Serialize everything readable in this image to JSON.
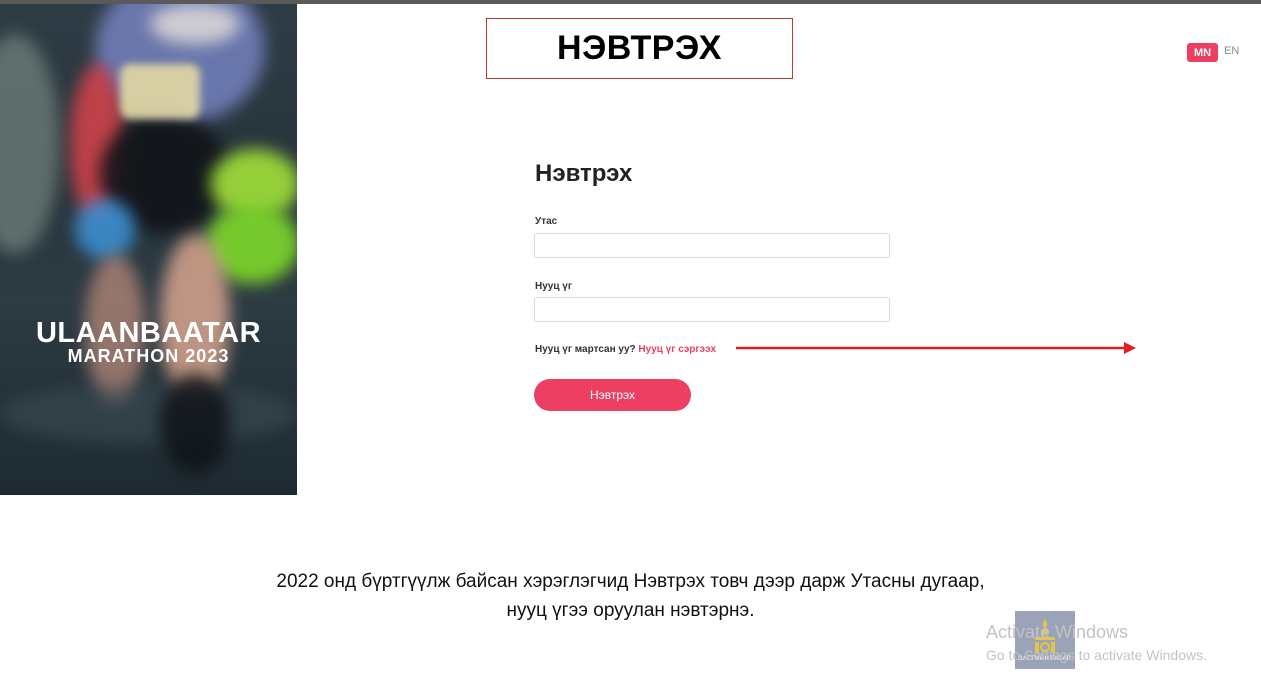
{
  "banner": {
    "title": "НЭВТРЭХ"
  },
  "hero": {
    "title": "ULAANBAATAR",
    "subtitle": "MARATHON 2023"
  },
  "language": {
    "active": "MN",
    "other": "EN"
  },
  "login_form": {
    "title": "Нэвтрэх",
    "phone_label": "Утас",
    "phone_value": "",
    "password_label": "Нууц үг",
    "password_value": "",
    "forgot_text": "Нууц үг мартсан уу?",
    "reset_link": "Нууц үг сэргээх",
    "submit_label": "Нэвтрэх"
  },
  "caption": {
    "line1": "2022 онд бүртгүүлж байсан хэрэглэгчид Нэвтрэх товч дээр дарж Утасны дугаар,",
    "line2": "нууц үгээ оруулан нэвтэрнэ."
  },
  "emblem": {
    "text": "ЗАСГИЙН ГАЗАР"
  },
  "watermark": {
    "line1": "Activate Windows",
    "line2": "Go to Settings to activate Windows."
  },
  "colors": {
    "accent": "#ec3f61",
    "annotation": "#c0392b",
    "arrow": "#e02020"
  }
}
